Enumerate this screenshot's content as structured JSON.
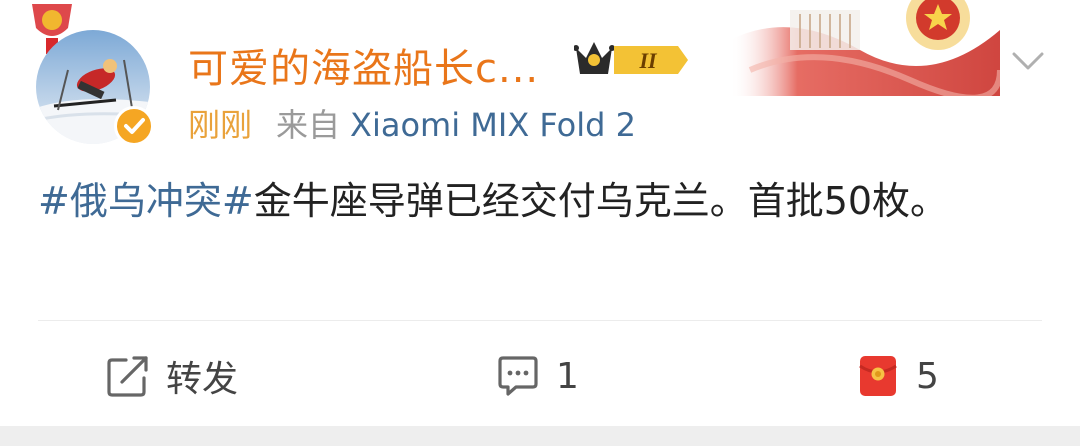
{
  "post": {
    "author": {
      "name": "可爱的海盗船长c...",
      "vip_level": "II"
    },
    "meta": {
      "time": "刚刚",
      "from_label": "来自",
      "device": "Xiaomi MIX Fold 2"
    },
    "content": {
      "topic": "#俄乌冲突#",
      "text": "金牛座导弹已经交付乌克兰。首批50枚。"
    },
    "actions": {
      "repost": {
        "icon": "share-icon",
        "label": "转发"
      },
      "comment": {
        "icon": "comment-icon",
        "count": "1"
      },
      "like": {
        "icon": "red-envelope-like-icon",
        "count": "5"
      }
    }
  },
  "colors": {
    "username": "#e9761a",
    "time": "#e9a23b",
    "link": "#3f6a95",
    "meta_gray": "#9a9a9a",
    "text": "#222222"
  }
}
